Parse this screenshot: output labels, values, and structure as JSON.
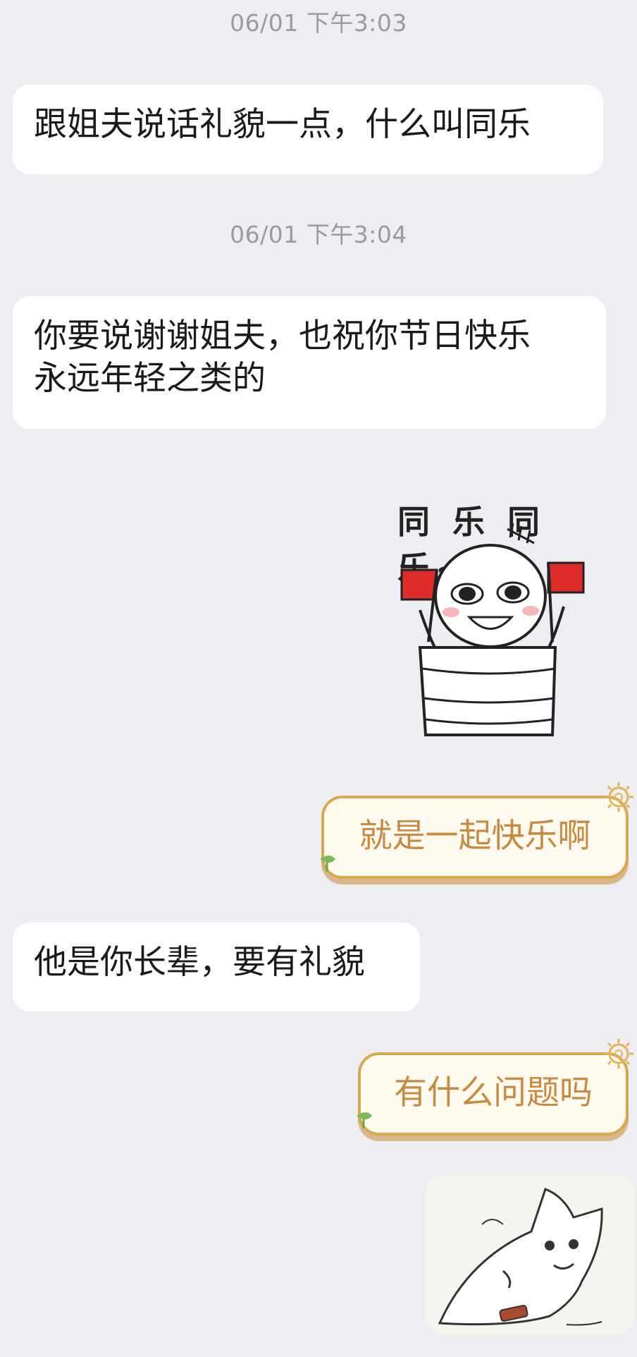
{
  "conversation": [
    {
      "type": "timestamp",
      "text": "06/01 下午3:03"
    },
    {
      "type": "incoming",
      "text": "跟姐夫说话礼貌一点，什么叫同乐"
    },
    {
      "type": "timestamp",
      "text": "06/01 下午3:04"
    },
    {
      "type": "incoming",
      "lines": [
        "你要说谢谢姐夫，也祝你节日快乐",
        "永远年轻之类的"
      ]
    },
    {
      "type": "outgoing-sticker",
      "caption": "同 乐 同 乐~",
      "icon": "sticker-flag-character"
    },
    {
      "type": "outgoing",
      "text": "就是一起快乐啊"
    },
    {
      "type": "incoming",
      "text": "他是你长辈，要有礼貌"
    },
    {
      "type": "outgoing",
      "text": "有什么问题吗"
    },
    {
      "type": "outgoing-sticker",
      "icon": "sticker-cat"
    }
  ],
  "colors": {
    "background": "#ededf2",
    "incoming_bubble": "#ffffff",
    "outgoing_text": "#c88a3e",
    "outgoing_border": "#d9a84e",
    "timestamp_text": "#9a9aa0"
  }
}
